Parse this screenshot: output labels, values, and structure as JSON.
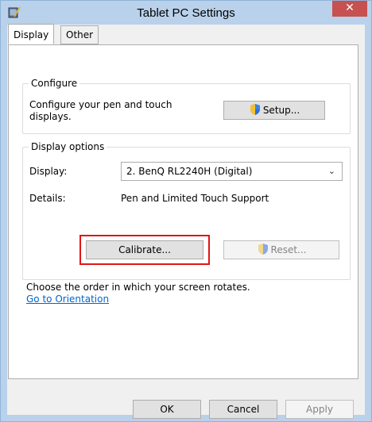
{
  "window": {
    "title": "Tablet PC Settings",
    "close_glyph": "✕"
  },
  "tabs": [
    {
      "label": "Display",
      "active": true
    },
    {
      "label": "Other",
      "active": false
    }
  ],
  "configure": {
    "legend": "Configure",
    "description": "Configure your pen and touch displays.",
    "setup_label": "Setup..."
  },
  "display_options": {
    "legend": "Display options",
    "display_label": "Display:",
    "display_value": "2. BenQ RL2240H (Digital)",
    "details_label": "Details:",
    "details_value": "Pen and Limited Touch Support",
    "calibrate_label": "Calibrate...",
    "reset_label": "Reset..."
  },
  "orientation": {
    "text": "Choose the order in which your screen rotates.",
    "link": "Go to Orientation"
  },
  "footer": {
    "ok": "OK",
    "cancel": "Cancel",
    "apply": "Apply"
  },
  "colors": {
    "highlight": "#e01616",
    "link": "#0066cc",
    "close": "#c75050"
  }
}
